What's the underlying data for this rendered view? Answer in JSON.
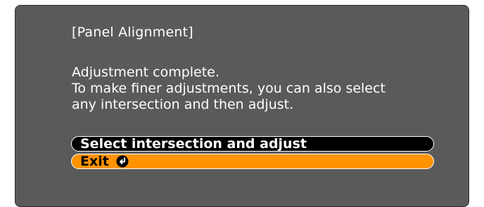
{
  "dialog": {
    "title": "[Panel Alignment]",
    "message_lines": [
      "Adjustment complete.",
      "To make finer adjustments, you can also select",
      "any intersection and then adjust."
    ]
  },
  "menu": {
    "items": [
      {
        "label": "Select intersection and adjust",
        "state": "normal"
      },
      {
        "label": "Exit",
        "state": "selected",
        "icon": "enter-icon"
      }
    ]
  },
  "colors": {
    "dialog_bg": "#5a5a5a",
    "item_bg": "#000000",
    "selected_bg": "#ff9300",
    "text": "#ffffff"
  }
}
